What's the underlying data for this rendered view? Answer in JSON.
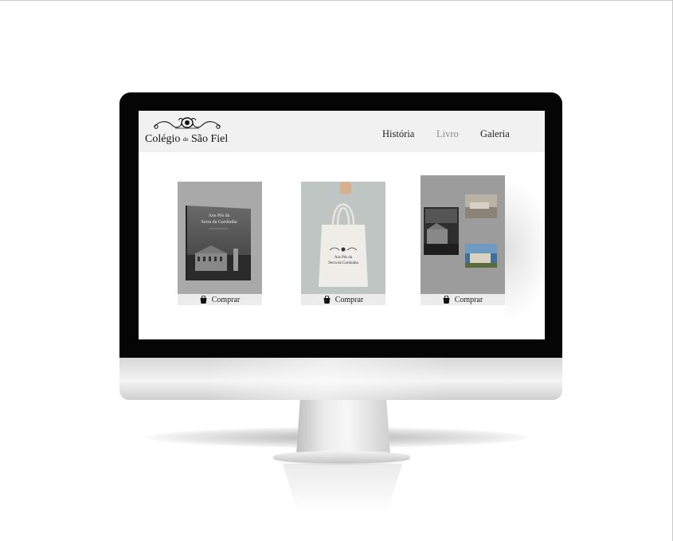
{
  "site": {
    "logo_main": "Colégio",
    "logo_small": "de",
    "logo_rest": "São Fiel",
    "nav": [
      {
        "label": "História",
        "active": false
      },
      {
        "label": "Livro",
        "active": true
      },
      {
        "label": "Galeria",
        "active": false
      }
    ]
  },
  "products": [
    {
      "type": "book",
      "cover_title": "Aos Pés da Serra da Gardunha",
      "buy_label": "Comprar",
      "icon": "shopping-bag-icon"
    },
    {
      "type": "tote-bag",
      "cover_title": "Aos Pés da Serra da Gardunha",
      "buy_label": "Comprar",
      "icon": "shopping-bag-icon"
    },
    {
      "type": "postcards",
      "buy_label": "Comprar",
      "icon": "shopping-bag-icon"
    }
  ],
  "colors": {
    "bezel": "#050505",
    "header_bg": "#f1f1f1",
    "nav_active": "#8a8a8a",
    "buy_bar": "#ececec",
    "card_bg": "#9c9c9c"
  }
}
